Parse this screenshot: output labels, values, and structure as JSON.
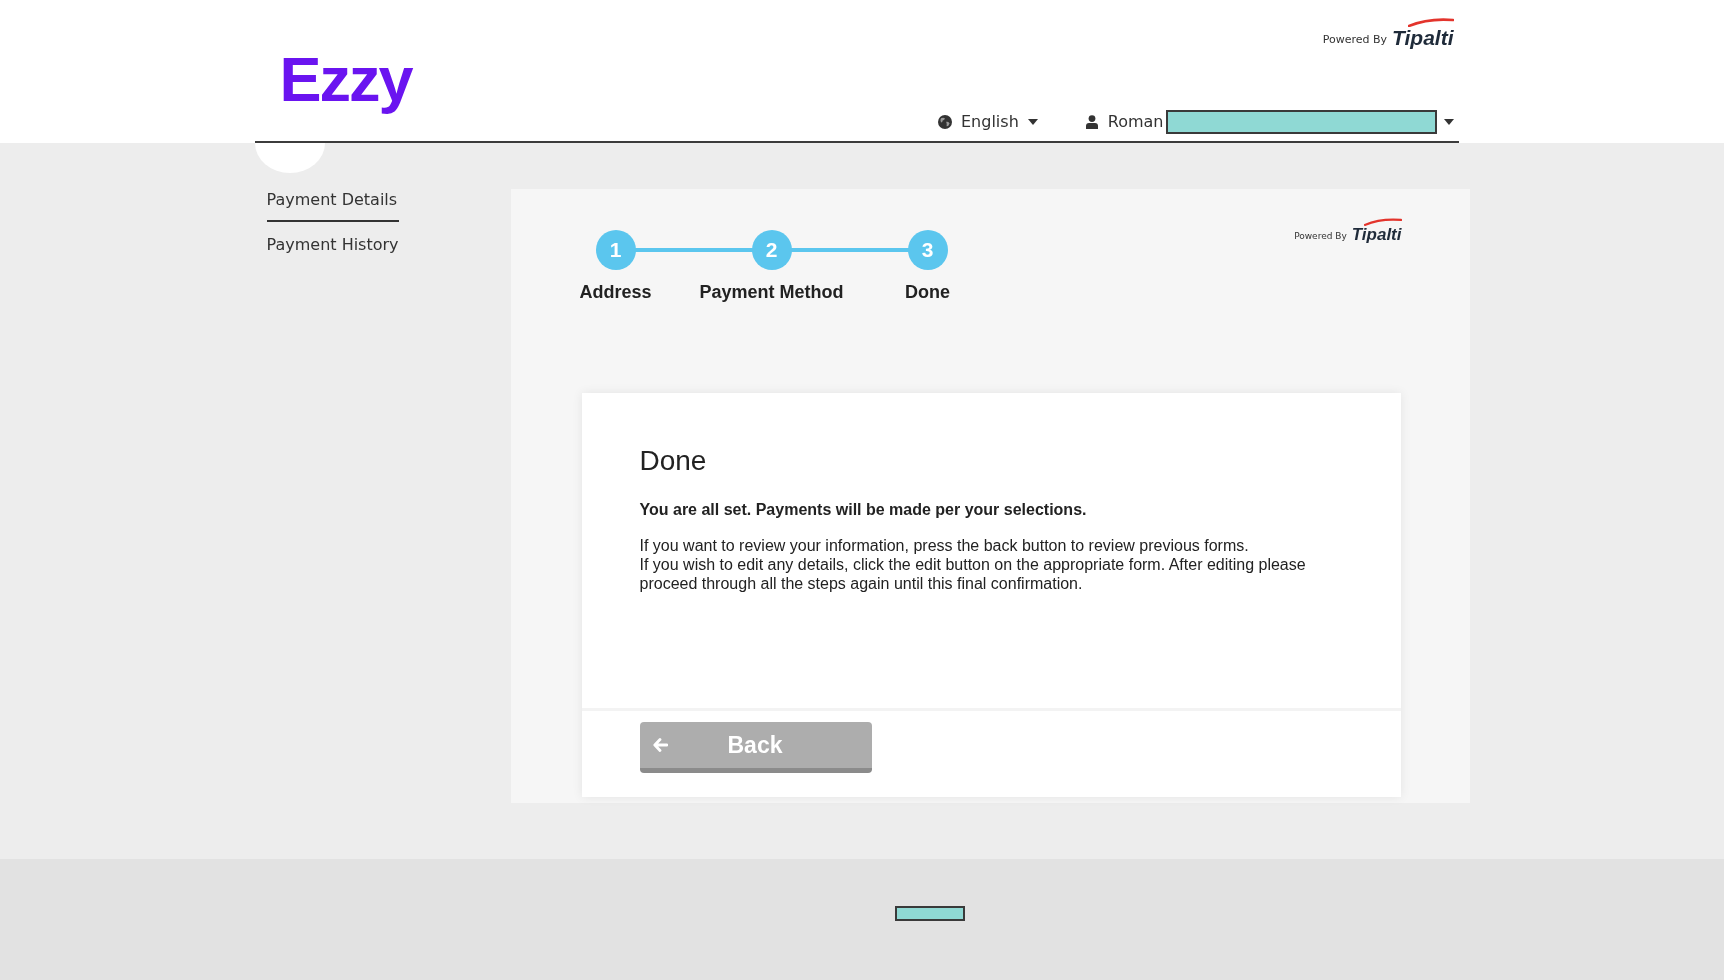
{
  "header": {
    "logo": "Ezzy",
    "powered_by": {
      "label": "Powered By",
      "brand": "Tipalti"
    },
    "language": {
      "label": "English"
    },
    "user": {
      "name": "Roman"
    }
  },
  "sidebar": {
    "items": [
      {
        "label": "Payment Details",
        "selected": true
      },
      {
        "label": "Payment History",
        "selected": false
      }
    ]
  },
  "panel": {
    "powered_by": {
      "label": "Powered By",
      "brand": "Tipalti"
    },
    "steps": [
      {
        "number": "1",
        "label": "Address"
      },
      {
        "number": "2",
        "label": "Payment Method"
      },
      {
        "number": "3",
        "label": "Done"
      }
    ],
    "card": {
      "title": "Done",
      "lead": "You are all set. Payments will be made per your selections.",
      "paragraphs": [
        "If you want to review your information, press the back button to review previous forms.",
        "If you wish to edit any details, click the edit button on the appropriate form. After editing please proceed through all the steps again until this final confirmation."
      ],
      "back_button": {
        "label": "Back"
      }
    }
  }
}
